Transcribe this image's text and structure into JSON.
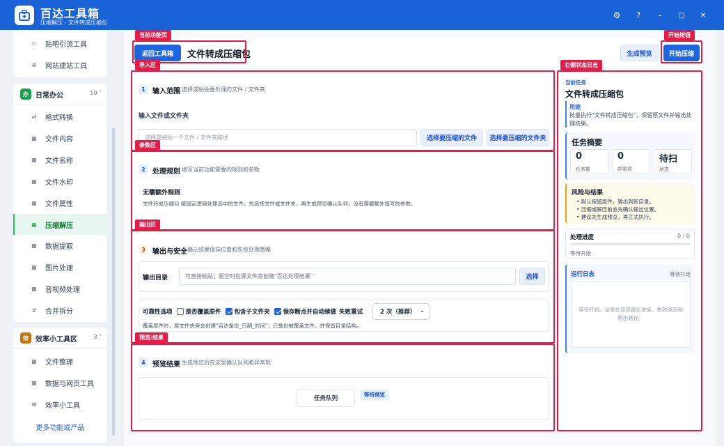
{
  "app": {
    "title": "百达工具箱",
    "subtitle": "压缩解压 - 文件转成压缩包"
  },
  "window": {
    "settings_icon": "⚙",
    "help_icon": "?",
    "min_icon": "-",
    "max_icon": "□",
    "close_icon": "✕"
  },
  "sidebar": {
    "top_items": [
      {
        "label": "贴吧引流工具",
        "icon": "▭"
      },
      {
        "label": "网站建站工具",
        "icon": "⊗"
      }
    ],
    "group_office": {
      "badge": "办",
      "name": "日常办公",
      "count": "10 ˄",
      "items": [
        {
          "label": "格式转换",
          "icon": "⇄"
        },
        {
          "label": "文件内容",
          "icon": "▦"
        },
        {
          "label": "文件名称",
          "icon": "▦"
        },
        {
          "label": "文件水印",
          "icon": "▦"
        },
        {
          "label": "文件属性",
          "icon": "▦"
        },
        {
          "label": "压缩解压",
          "icon": "▦"
        },
        {
          "label": "数据提取",
          "icon": "▦"
        },
        {
          "label": "图片处理",
          "icon": "▦"
        },
        {
          "label": "音视频处理",
          "icon": "▦"
        },
        {
          "label": "合并拆分",
          "icon": "#"
        }
      ]
    },
    "group_tools": {
      "badge": "效",
      "name": "效率小工具区",
      "count": "3 ˄",
      "items": [
        {
          "label": "文件整理",
          "icon": "▦"
        },
        {
          "label": "数据与网页工具",
          "icon": "▦"
        },
        {
          "label": "效率小工具",
          "icon": "⊞"
        }
      ]
    },
    "more_link": "更多功能或产品"
  },
  "annotations": {
    "current_page": "当前功能页",
    "start_button": "开始按钮",
    "import_area": "导入区",
    "right_log": "右侧状态日志",
    "param_area": "参数区",
    "output_area": "输出区",
    "preview_area": "预览/结果"
  },
  "header": {
    "back_button": "返回工具箱",
    "page_title": "文件转成压缩包",
    "preview_button": "生成预览",
    "start_button": "开始压缩"
  },
  "section_input": {
    "num": "1",
    "title": "输入范围",
    "desc": "选择或粘贴要处理的文件 / 文件夹",
    "field_label": "输入文件或文件夹",
    "placeholder": "选择或粘贴一个文件 / 文件夹路径",
    "choose_file": "选择要压缩的文件",
    "choose_folder": "选择要压缩的文件夹"
  },
  "section_rules": {
    "num": "2",
    "title": "处理规则",
    "desc": "填写当前功能需要的规则和参数",
    "subtitle": "无需额外规则",
    "text": "文件转成压缩包 按固定逻辑处理选中的文件。先选择文件或文件夹，再生成预览确认队列；没有需要额外填写的参数。"
  },
  "section_output": {
    "num": "3",
    "title": "输出与安全",
    "desc": "确认结果保存位置和失败处理策略",
    "dir_label": "输出目录",
    "dir_placeholder": "可直接粘贴；留空时在源文件旁创建\"百达处理结果\"",
    "choose": "选择",
    "reliability_label": "可靠性选项",
    "opt_overwrite": "是否覆盖原件",
    "opt_subfolders": "包含子文件夹",
    "opt_resume": "保存断点并自动续做",
    "retry_label": "失败重试",
    "retry_value": "2 次（推荐）",
    "note": "覆盖原件时，原文件夹旁会创建\"百达备份_日期_时间\"；只备份被覆盖文件，并保留目录结构。"
  },
  "section_preview": {
    "num": "4",
    "title": "预览结果",
    "desc": "生成预览后在这里确认队列和异常项",
    "queue_button": "任务队列",
    "status_badge": "等待预览"
  },
  "right_panel": {
    "current_task_label": "当前任务",
    "task_title": "文件转成压缩包",
    "usage_label": "用途",
    "usage_text": "批量执行\"文件转成压缩包\"，保留原文件并输出处理结果。",
    "summary_title": "任务摘要",
    "stats": [
      {
        "value": "0",
        "label": "任务数"
      },
      {
        "value": "0",
        "label": "异常项"
      },
      {
        "value": "待扫",
        "label": "状态"
      }
    ],
    "risk_title": "风险与结果",
    "risks": [
      "默认保留原件，输出到新目录。",
      "压缩或解压前会先确认输出位置。",
      "建议先生成预览，再正式执行。"
    ],
    "progress_title": "处理进度",
    "progress_count": "0 / 0",
    "progress_value": 0,
    "progress_status": "等待开始",
    "log_title": "运行日志",
    "log_status": "等待开始",
    "log_text": "等待开始。这里会显示最近进度、失败原因和输出路径。"
  }
}
